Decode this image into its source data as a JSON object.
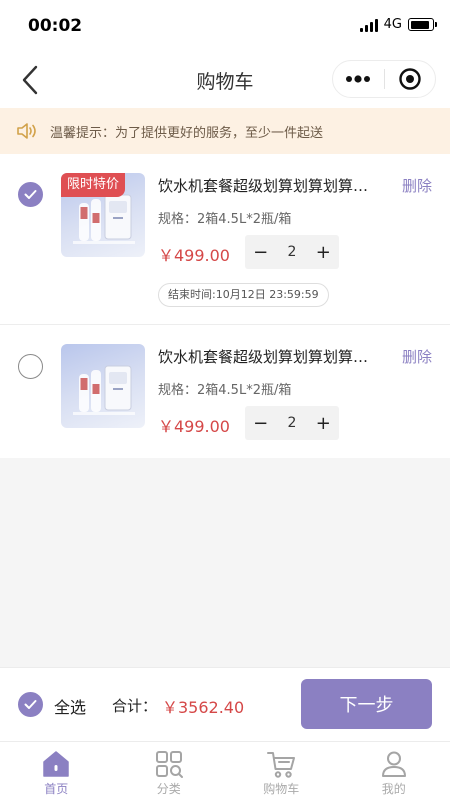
{
  "status_bar": {
    "time": "00:02",
    "network": "4G",
    "battery_level": 0.9
  },
  "nav": {
    "title": "购物车",
    "back_icon": "chevron-left-icon",
    "more_icon": "more-dots-icon",
    "target_icon": "target-icon"
  },
  "notice": {
    "icon": "speaker-icon",
    "text": "温馨提示：为了提供更好的服务，至少一件起送"
  },
  "cart_items": [
    {
      "selected": true,
      "promo_tag": "限时特价",
      "name": "饮水机套餐超级划算划算划算划算",
      "delete_label": "删除",
      "spec": "规格：2箱4.5L*2瓶/箱",
      "price": "￥499.00",
      "quantity": "2",
      "minus": "−",
      "plus": "+",
      "end_time": "结束时间:10月12日 23:59:59"
    },
    {
      "selected": false,
      "name": "饮水机套餐超级划算划算划算划算",
      "delete_label": "删除",
      "spec": "规格：2箱4.5L*2瓶/箱",
      "price": "￥499.00",
      "quantity": "2",
      "minus": "−",
      "plus": "+"
    }
  ],
  "bottom_bar": {
    "select_all_checked": true,
    "select_all_label": "全选",
    "total_label": "合计：",
    "total_value": "￥3562.40",
    "next_label": "下一步"
  },
  "tabs": [
    {
      "label": "首页",
      "icon": "home-icon",
      "active": true
    },
    {
      "label": "分类",
      "icon": "category-grid-icon",
      "active": false
    },
    {
      "label": "购物车",
      "icon": "cart-icon",
      "active": false
    },
    {
      "label": "我的",
      "icon": "user-icon",
      "active": false
    }
  ],
  "colors": {
    "accent": "#8b80c2",
    "price": "#d54848",
    "promo": "#df4f53",
    "notice_bg": "#fdf1e3"
  }
}
